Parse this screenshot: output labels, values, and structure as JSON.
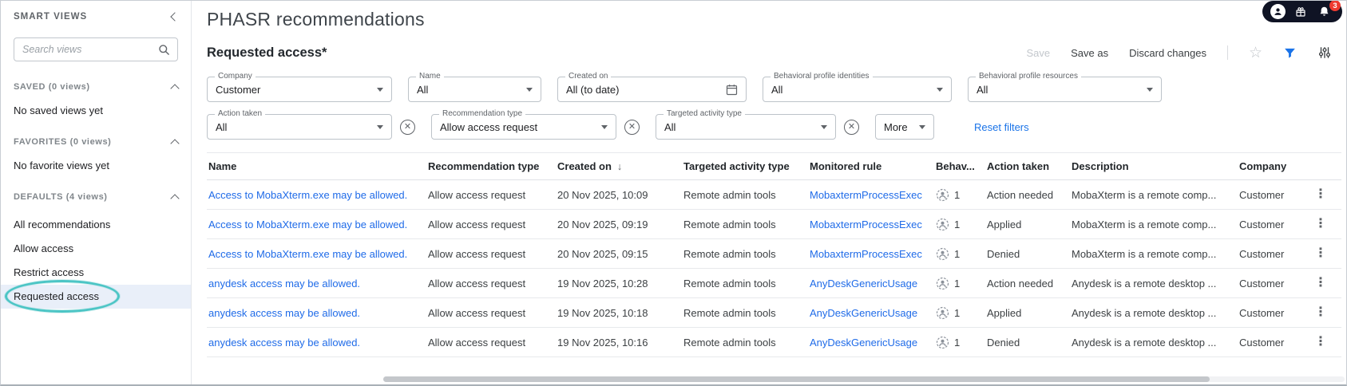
{
  "colors": {
    "accent_blue": "#1a73e8",
    "link_blue": "#1f6be8",
    "annotation_teal": "#4cc5c5",
    "badge_red": "#ee3a30",
    "pill_dark": "#0f1324",
    "selected_item_bg": "#e9eff9"
  },
  "sidebar": {
    "title": "SMART VIEWS",
    "search_placeholder": "Search views",
    "sections": [
      {
        "label": "SAVED (0 views)",
        "empty_text": "No saved views yet"
      },
      {
        "label": "FAVORITES (0 views)",
        "empty_text": "No favorite views yet"
      },
      {
        "label": "DEFAULTS (4 views)",
        "items": [
          "All recommendations",
          "Allow access",
          "Restrict access",
          "Requested access"
        ],
        "selected_item": "Requested access"
      }
    ]
  },
  "header": {
    "page_title": "PHASR recommendations",
    "view_title": "Requested access*",
    "actions": {
      "save": "Save",
      "save_as": "Save as",
      "discard": "Discard changes"
    },
    "notifications_count": "3"
  },
  "filters": {
    "row1": [
      {
        "label": "Company",
        "value": "Customer"
      },
      {
        "label": "Name",
        "value": "All"
      },
      {
        "label": "Created on",
        "value": "All (to date)"
      },
      {
        "label": "Behavioral profile identities",
        "value": "All"
      },
      {
        "label": "Behavioral profile resources",
        "value": "All"
      }
    ],
    "row2": [
      {
        "label": "Action taken",
        "value": "All"
      },
      {
        "label": "Recommendation type",
        "value": "Allow access request"
      },
      {
        "label": "Targeted activity type",
        "value": "All"
      }
    ],
    "more_label": "More",
    "reset_label": "Reset filters"
  },
  "table": {
    "columns": [
      {
        "label": "Name"
      },
      {
        "label": "Recommendation type"
      },
      {
        "label": "Created on",
        "sort_icon": "↓"
      },
      {
        "label": "Targeted activity type"
      },
      {
        "label": "Monitored rule"
      },
      {
        "label": "Behav..."
      },
      {
        "label": "Action taken"
      },
      {
        "label": "Description"
      },
      {
        "label": "Company"
      },
      {
        "label": ""
      }
    ],
    "rows": [
      {
        "name": "Access to MobaXterm.exe may be allowed.",
        "recommendation_type": "Allow access request",
        "created_on": "20 Nov 2025, 10:09",
        "targeted_activity_type": "Remote admin tools",
        "monitored_rule": "MobaxtermProcessExec",
        "behavior_count": "1",
        "action_taken": "Action needed",
        "description": "MobaXterm is a remote comp...",
        "company": "Customer"
      },
      {
        "name": "Access to MobaXterm.exe may be allowed.",
        "recommendation_type": "Allow access request",
        "created_on": "20 Nov 2025, 09:19",
        "targeted_activity_type": "Remote admin tools",
        "monitored_rule": "MobaxtermProcessExec",
        "behavior_count": "1",
        "action_taken": "Applied",
        "description": "MobaXterm is a remote comp...",
        "company": "Customer"
      },
      {
        "name": "Access to MobaXterm.exe may be allowed.",
        "recommendation_type": "Allow access request",
        "created_on": "20 Nov 2025, 09:15",
        "targeted_activity_type": "Remote admin tools",
        "monitored_rule": "MobaxtermProcessExec",
        "behavior_count": "1",
        "action_taken": "Denied",
        "description": "MobaXterm is a remote comp...",
        "company": "Customer"
      },
      {
        "name": "anydesk access may be allowed.",
        "recommendation_type": "Allow access request",
        "created_on": "19 Nov 2025, 10:28",
        "targeted_activity_type": "Remote admin tools",
        "monitored_rule": "AnyDeskGenericUsage",
        "behavior_count": "1",
        "action_taken": "Action needed",
        "description": "Anydesk is a remote desktop ...",
        "company": "Customer"
      },
      {
        "name": "anydesk access may be allowed.",
        "recommendation_type": "Allow access request",
        "created_on": "19 Nov 2025, 10:18",
        "targeted_activity_type": "Remote admin tools",
        "monitored_rule": "AnyDeskGenericUsage",
        "behavior_count": "1",
        "action_taken": "Applied",
        "description": "Anydesk is a remote desktop ...",
        "company": "Customer"
      },
      {
        "name": "anydesk access may be allowed.",
        "recommendation_type": "Allow access request",
        "created_on": "19 Nov 2025, 10:16",
        "targeted_activity_type": "Remote admin tools",
        "monitored_rule": "AnyDeskGenericUsage",
        "behavior_count": "1",
        "action_taken": "Denied",
        "description": "Anydesk is a remote desktop ...",
        "company": "Customer"
      }
    ]
  }
}
